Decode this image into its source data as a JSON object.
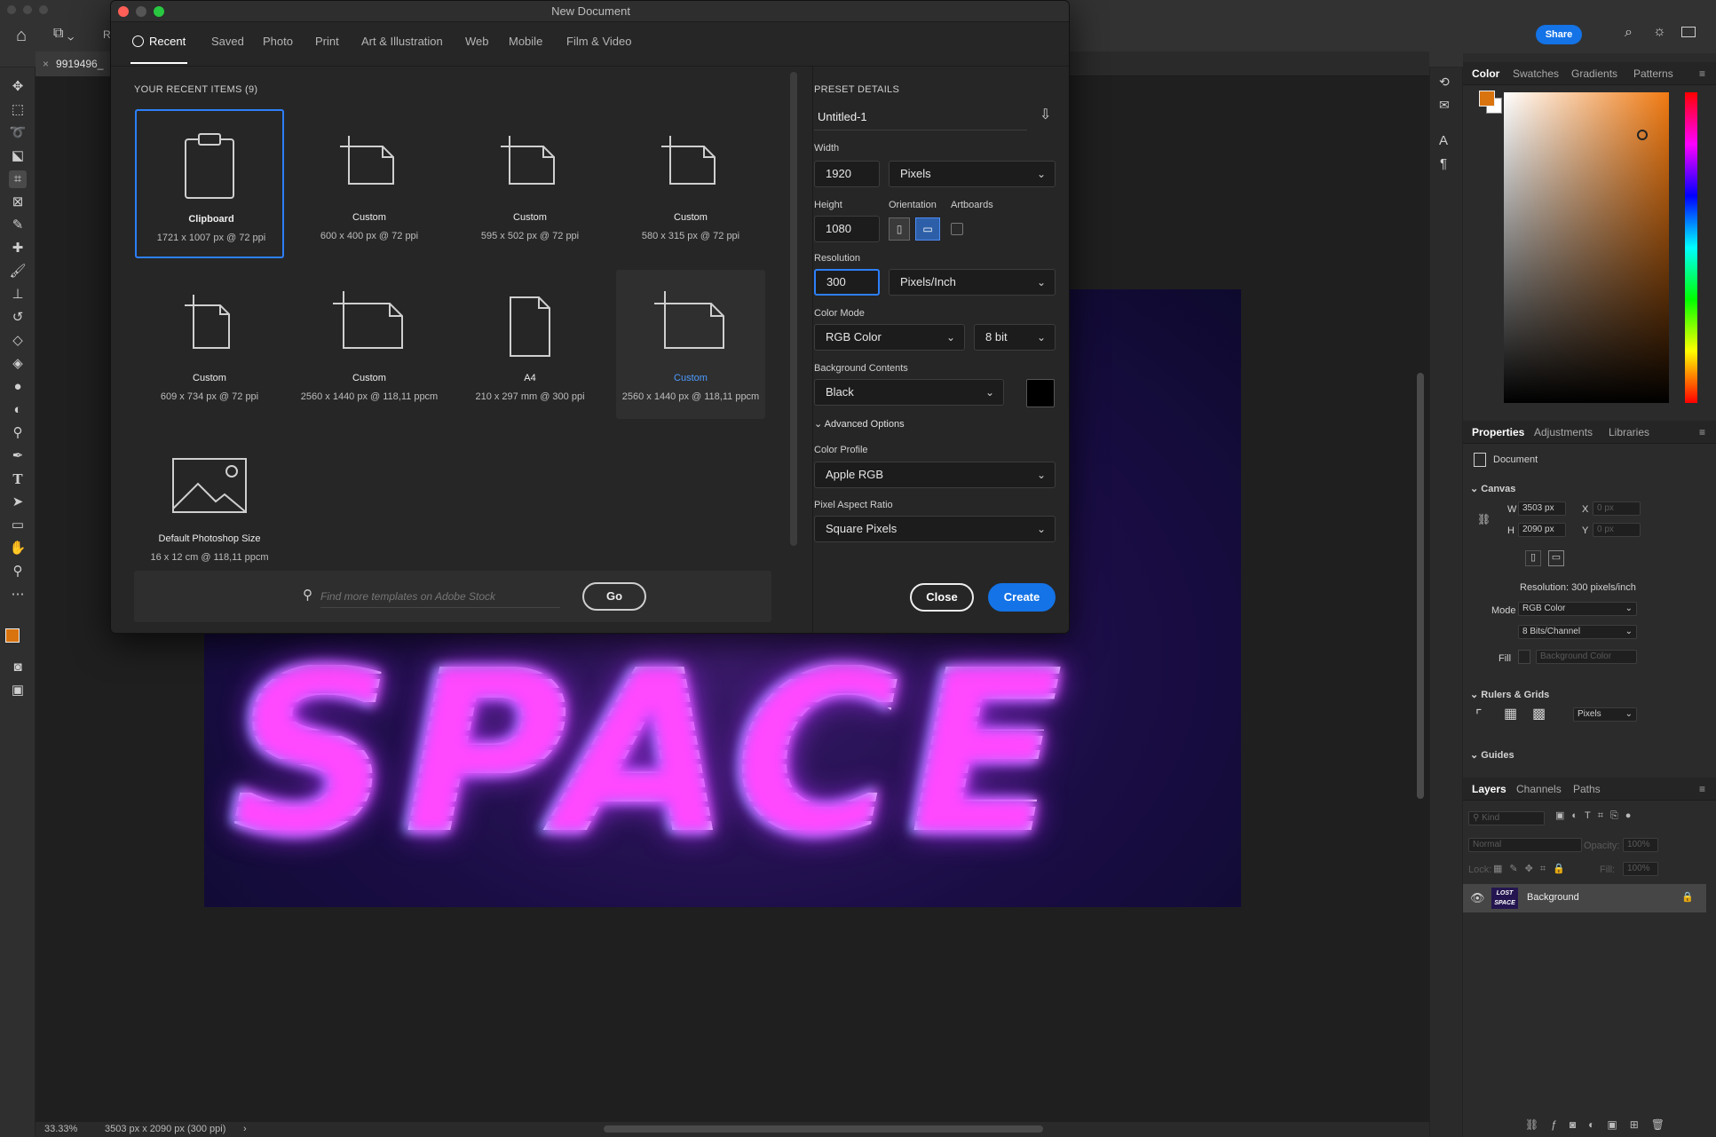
{
  "app": {
    "doc_tab_name": "9919496_",
    "share_label": "Share",
    "tool_option_letter": "R",
    "zoom": "33.33%",
    "doc_info": "3503 px x 2090 px (300 ppi)",
    "artwork_text": "SPACE"
  },
  "dialog": {
    "title": "New Document",
    "tabs": [
      "Recent",
      "Saved",
      "Photo",
      "Print",
      "Art & Illustration",
      "Web",
      "Mobile",
      "Film & Video"
    ],
    "recent_heading": "YOUR RECENT ITEMS",
    "recent_count": "(9)",
    "items": [
      {
        "name": "Clipboard",
        "desc": "1721 x 1007 px @ 72 ppi"
      },
      {
        "name": "Custom",
        "desc": "600 x 400 px @ 72 ppi"
      },
      {
        "name": "Custom",
        "desc": "595 x 502 px @ 72 ppi"
      },
      {
        "name": "Custom",
        "desc": "580 x 315 px @ 72 ppi"
      },
      {
        "name": "Custom",
        "desc": "609 x 734 px @ 72 ppi"
      },
      {
        "name": "Custom",
        "desc": "2560 x 1440 px @ 118,11 ppcm"
      },
      {
        "name": "A4",
        "desc": "210 x 297 mm @ 300 ppi"
      },
      {
        "name": "Custom",
        "desc": "2560 x 1440 px @ 118,11 ppcm"
      },
      {
        "name": "Default Photoshop Size",
        "desc": "16 x 12 cm @ 118,11 ppcm"
      }
    ],
    "search_placeholder": "Find more templates on Adobe Stock",
    "go_label": "Go",
    "preset": {
      "heading": "PRESET DETAILS",
      "name": "Untitled-1",
      "width_label": "Width",
      "width": "1920",
      "width_unit": "Pixels",
      "height_label": "Height",
      "height": "1080",
      "orientation_label": "Orientation",
      "artboards_label": "Artboards",
      "resolution_label": "Resolution",
      "resolution": "300",
      "resolution_unit": "Pixels/Inch",
      "color_mode_label": "Color Mode",
      "color_mode": "RGB Color",
      "bit_depth": "8 bit",
      "bg_label": "Background Contents",
      "bg": "Black",
      "bg_color": "#000000",
      "advanced_label": "Advanced Options",
      "profile_label": "Color Profile",
      "profile": "Apple RGB",
      "par_label": "Pixel Aspect Ratio",
      "par": "Square Pixels"
    },
    "close_label": "Close",
    "create_label": "Create"
  },
  "panels": {
    "color_tabs": [
      "Color",
      "Swatches",
      "Gradients",
      "Patterns"
    ],
    "foreground_color": "#d9730d",
    "props_tabs": [
      "Properties",
      "Adjustments",
      "Libraries"
    ],
    "document_label": "Document",
    "canvas_section": "Canvas",
    "w_label": "W",
    "w_value": "3503 px",
    "h_label": "H",
    "h_value": "2090 px",
    "x_label": "X",
    "x_value": "0 px",
    "y_label": "Y",
    "y_value": "0 px",
    "resolution_text": "Resolution: 300 pixels/inch",
    "mode_label": "Mode",
    "mode_value": "RGB Color",
    "bits_value": "8 Bits/Channel",
    "fill_label": "Fill",
    "fill_value": "Background Color",
    "rulers_section": "Rulers & Grids",
    "rulers_unit": "Pixels",
    "guides_section": "Guides",
    "layers_tabs": [
      "Layers",
      "Channels",
      "Paths"
    ],
    "kind_placeholder": "Kind",
    "blend_mode": "Normal",
    "opacity_label": "Opacity:",
    "opacity_value": "100%",
    "lock_label": "Lock:",
    "fill2_label": "Fill:",
    "fill2_value": "100%",
    "layer_name": "Background",
    "layer_thumb_text": "LOST SPACE"
  }
}
